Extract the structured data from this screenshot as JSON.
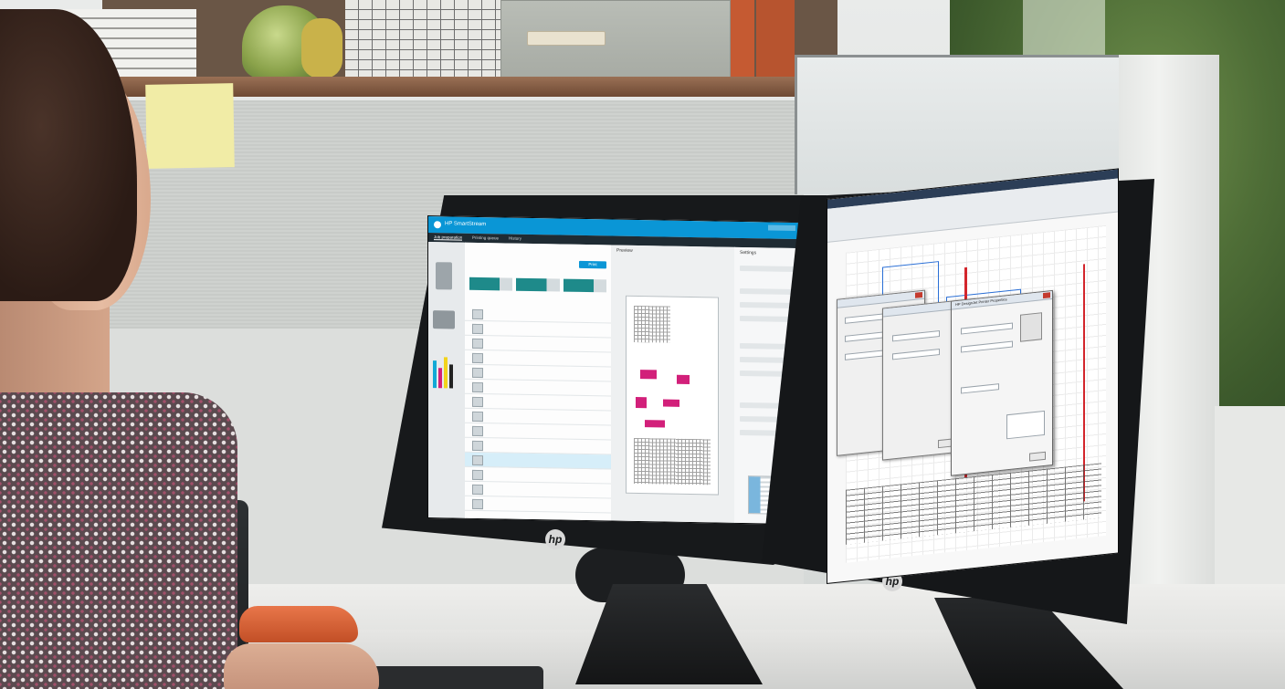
{
  "screen_left": {
    "app_title": "HP SmartStream",
    "tabs": [
      "Job preparation",
      "Printing queue",
      "History"
    ],
    "active_tab": "Job preparation",
    "print_button": "Print",
    "panel_preview": "Preview",
    "panel_settings": "Settings"
  },
  "screen_right": {
    "dialog_title": "HP DesignJet Printer Properties"
  },
  "monitor_brand": "hp",
  "colors": {
    "titlebar_blue": "#0a96d6",
    "ink_cyan": "#12a9d6",
    "ink_magenta": "#d2207a",
    "ink_yellow": "#f2d31c",
    "ink_black": "#222222"
  }
}
